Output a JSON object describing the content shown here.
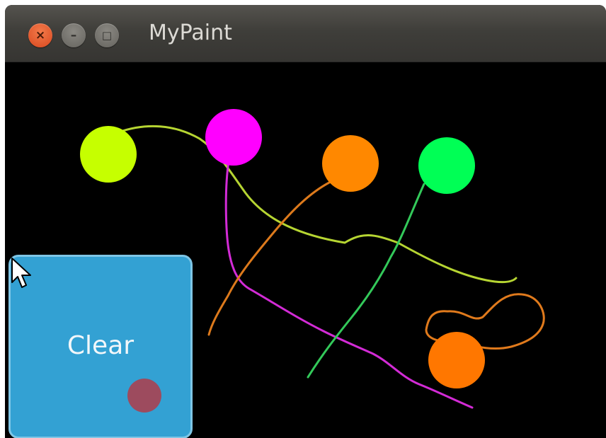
{
  "window": {
    "title": "MyPaint",
    "controls": {
      "close": "×",
      "minimize": "–",
      "maximize": "□"
    }
  },
  "canvas": {
    "background": "#000000",
    "circles": [
      {
        "id": "circle-1",
        "color": "#c6ff00"
      },
      {
        "id": "circle-2",
        "color": "#ff00ff"
      },
      {
        "id": "circle-3",
        "color": "#ff8800"
      },
      {
        "id": "circle-4",
        "color": "#00ff55"
      },
      {
        "id": "circle-5",
        "color": "#ff7700"
      }
    ],
    "stroke_colors": [
      "#b6d532",
      "#d32bd6",
      "#dd7a1c",
      "#33c95a",
      "#e07a1c"
    ]
  },
  "clear_button": {
    "label": "Clear",
    "color": "#33a1d3"
  }
}
